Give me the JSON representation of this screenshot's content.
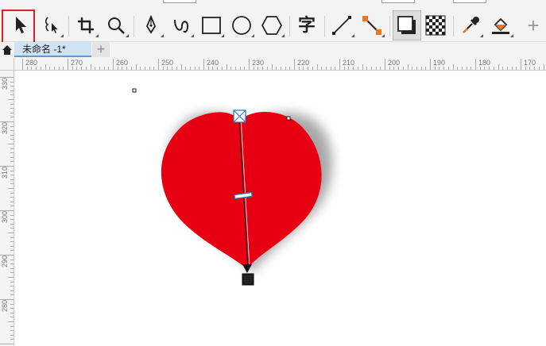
{
  "toolbar": {
    "tools": [
      {
        "id": "pick",
        "icon": "pick-arrow-icon",
        "selected": true
      },
      {
        "id": "freehand-pick",
        "icon": "freehand-pick-icon"
      },
      {
        "id": "crop",
        "icon": "crop-icon"
      },
      {
        "id": "zoom",
        "icon": "zoom-icon"
      },
      {
        "id": "pen",
        "icon": "pen-icon"
      },
      {
        "id": "curve",
        "icon": "curve-icon"
      },
      {
        "id": "rectangle",
        "icon": "rectangle-icon"
      },
      {
        "id": "ellipse",
        "icon": "ellipse-icon"
      },
      {
        "id": "polygon",
        "icon": "polygon-icon"
      },
      {
        "id": "text",
        "icon": "text-icon",
        "glyph": "字"
      },
      {
        "id": "line",
        "icon": "line-icon"
      },
      {
        "id": "connector",
        "icon": "connector-icon"
      },
      {
        "id": "drop-shadow",
        "icon": "drop-shadow-icon"
      },
      {
        "id": "transparency",
        "icon": "transparency-icon"
      },
      {
        "id": "eyedropper",
        "icon": "eyedropper-icon"
      },
      {
        "id": "interactive-fill",
        "icon": "fill-bucket-icon"
      },
      {
        "id": "add-tool",
        "icon": "plus-icon",
        "glyph": "+"
      }
    ],
    "accent_color": "#e02020"
  },
  "tabs": {
    "document": "未命名 -1*",
    "add": "+"
  },
  "rulers": {
    "horizontal": [
      "280",
      "270",
      "260",
      "250",
      "240",
      "230",
      "220",
      "210",
      "200",
      "190",
      "180",
      "170"
    ],
    "vertical": [
      "330",
      "320",
      "310",
      "300",
      "290",
      "280"
    ]
  },
  "canvas": {
    "heart_color": "#e60012",
    "shadow_color": "#8a8a8a"
  }
}
